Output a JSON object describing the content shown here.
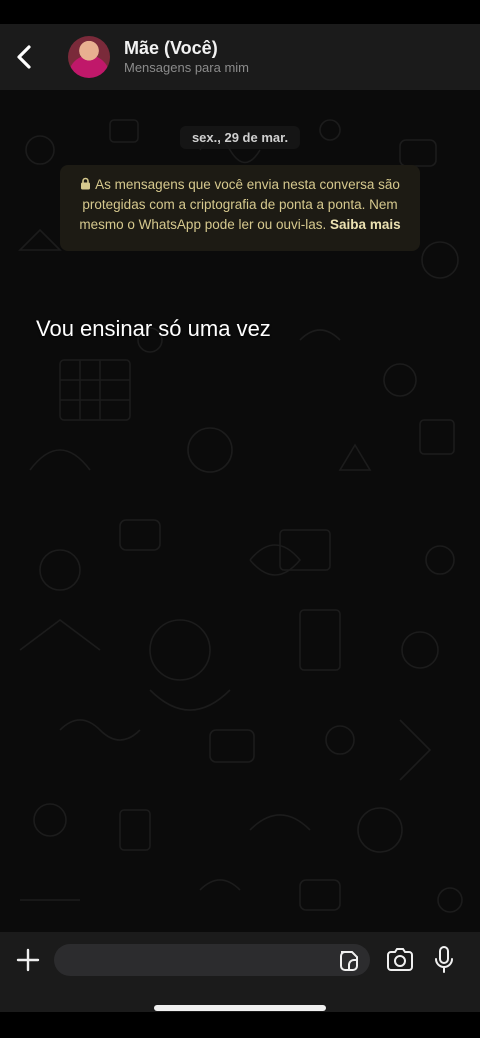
{
  "header": {
    "title": "Mãe (Você)",
    "subtitle": "Mensagens para mim"
  },
  "chat": {
    "date": "sex., 29 de mar.",
    "encryption_notice": "As mensagens que você envia nesta conversa são protegidas com a criptografia de ponta a ponta. Nem mesmo o WhatsApp pode ler ou ouvi-las.",
    "learn_more": "Saiba mais"
  },
  "overlay": {
    "caption": "Vou ensinar só uma vez"
  },
  "input": {
    "value": "",
    "placeholder": ""
  },
  "icons": {
    "back": "chevron-left-icon",
    "lock": "lock-icon",
    "plus": "plus-icon",
    "sticker": "sticker-icon",
    "camera": "camera-icon",
    "mic": "microphone-icon"
  },
  "colors": {
    "header_bg": "#1b1b1b",
    "chat_bg": "#0b0b0b",
    "encryption_text": "#d6c98e",
    "subtitle": "#8b8b8b"
  }
}
